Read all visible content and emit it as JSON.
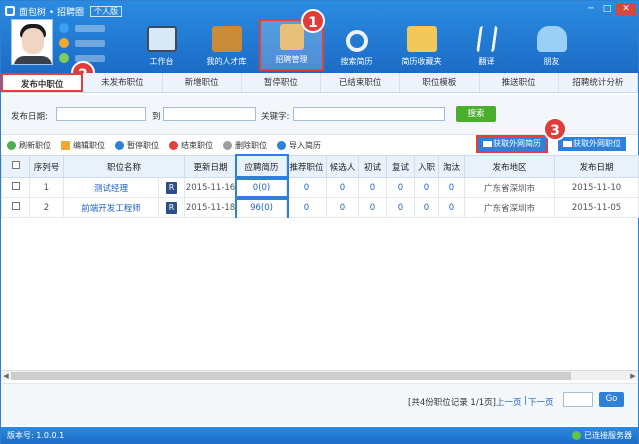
{
  "window": {
    "title": "面包树 • 招聘圈",
    "edition": "个人版",
    "controls": [
      "─",
      "□",
      "✕"
    ]
  },
  "profile": {
    "icon_colors": [
      "#3aa0f2",
      "#f0a830",
      "#7ad05a"
    ]
  },
  "nav": [
    {
      "label": "工作台",
      "icon": "monitor-icon",
      "color": "#d9e8f7"
    },
    {
      "label": "我的人才库",
      "icon": "briefcase-icon",
      "color": "#c98a3a"
    },
    {
      "label": "招聘管理",
      "icon": "clipboard-icon",
      "color": "#e7c07a"
    },
    {
      "label": "搜索简历",
      "icon": "magnifier-icon",
      "color": "#eaf3fb"
    },
    {
      "label": "简历收藏夹",
      "icon": "folder-icon",
      "color": "#f2c85b"
    },
    {
      "label": "翻译",
      "icon": "compass-icon",
      "color": "#f4f4f4"
    },
    {
      "label": "朋友",
      "icon": "people-icon",
      "color": "#9ad0f5"
    }
  ],
  "badges": [
    "1",
    "2",
    "3"
  ],
  "tabs": [
    "发布中职位",
    "未发布职位",
    "新增职位",
    "暂停职位",
    "已结束职位",
    "职位模板",
    "推送职位",
    "招聘统计分析"
  ],
  "search": {
    "date_label": "发布日期:",
    "to_label": "到",
    "keyword_label": "关键字:",
    "button": "搜索"
  },
  "toolbar": [
    {
      "label": "刷新职位",
      "icon": "refresh-icon",
      "color": "#4caf50"
    },
    {
      "label": "编辑职位",
      "icon": "edit-icon",
      "color": "#f0a830"
    },
    {
      "label": "暂停职位",
      "icon": "pause-icon",
      "color": "#2f80d8"
    },
    {
      "label": "结束职位",
      "icon": "stop-icon",
      "color": "#e53e3e"
    },
    {
      "label": "删除职位",
      "icon": "trash-icon",
      "color": "#9e9e9e"
    },
    {
      "label": "导入简历",
      "icon": "import-icon",
      "color": "#2f80d8"
    }
  ],
  "ext_buttons": [
    "获取外网简历",
    "获取外网职位"
  ],
  "table": {
    "headers": [
      "序列号",
      "职位名称",
      "",
      "更新日期",
      "应聘简历",
      "推荐职位",
      "候选人",
      "初试",
      "复试",
      "入职",
      "淘汰",
      "发布地区",
      "发布日期"
    ],
    "rows": [
      {
        "no": "1",
        "title": "测试经理",
        "updated": "2015-11-16",
        "applied": "0(0)",
        "recommend": "0",
        "candidates": "0",
        "first": "0",
        "second": "0",
        "hired": "0",
        "out": "0",
        "region": "广东省深圳市",
        "published": "2015-11-10"
      },
      {
        "no": "2",
        "title": "前端开发工程师",
        "updated": "2015-11-18",
        "applied": "96(0)",
        "recommend": "0",
        "candidates": "0",
        "first": "0",
        "second": "0",
        "hired": "0",
        "out": "0",
        "region": "广东省深圳市",
        "published": "2015-11-05"
      }
    ]
  },
  "pager": {
    "summary": "[共4份职位记录 1/1页]",
    "prev": "上一页",
    "next": "下一页",
    "go": "Go"
  },
  "status": {
    "version": "版本号: 1.0.0.1",
    "connection": "已连接服务器"
  }
}
